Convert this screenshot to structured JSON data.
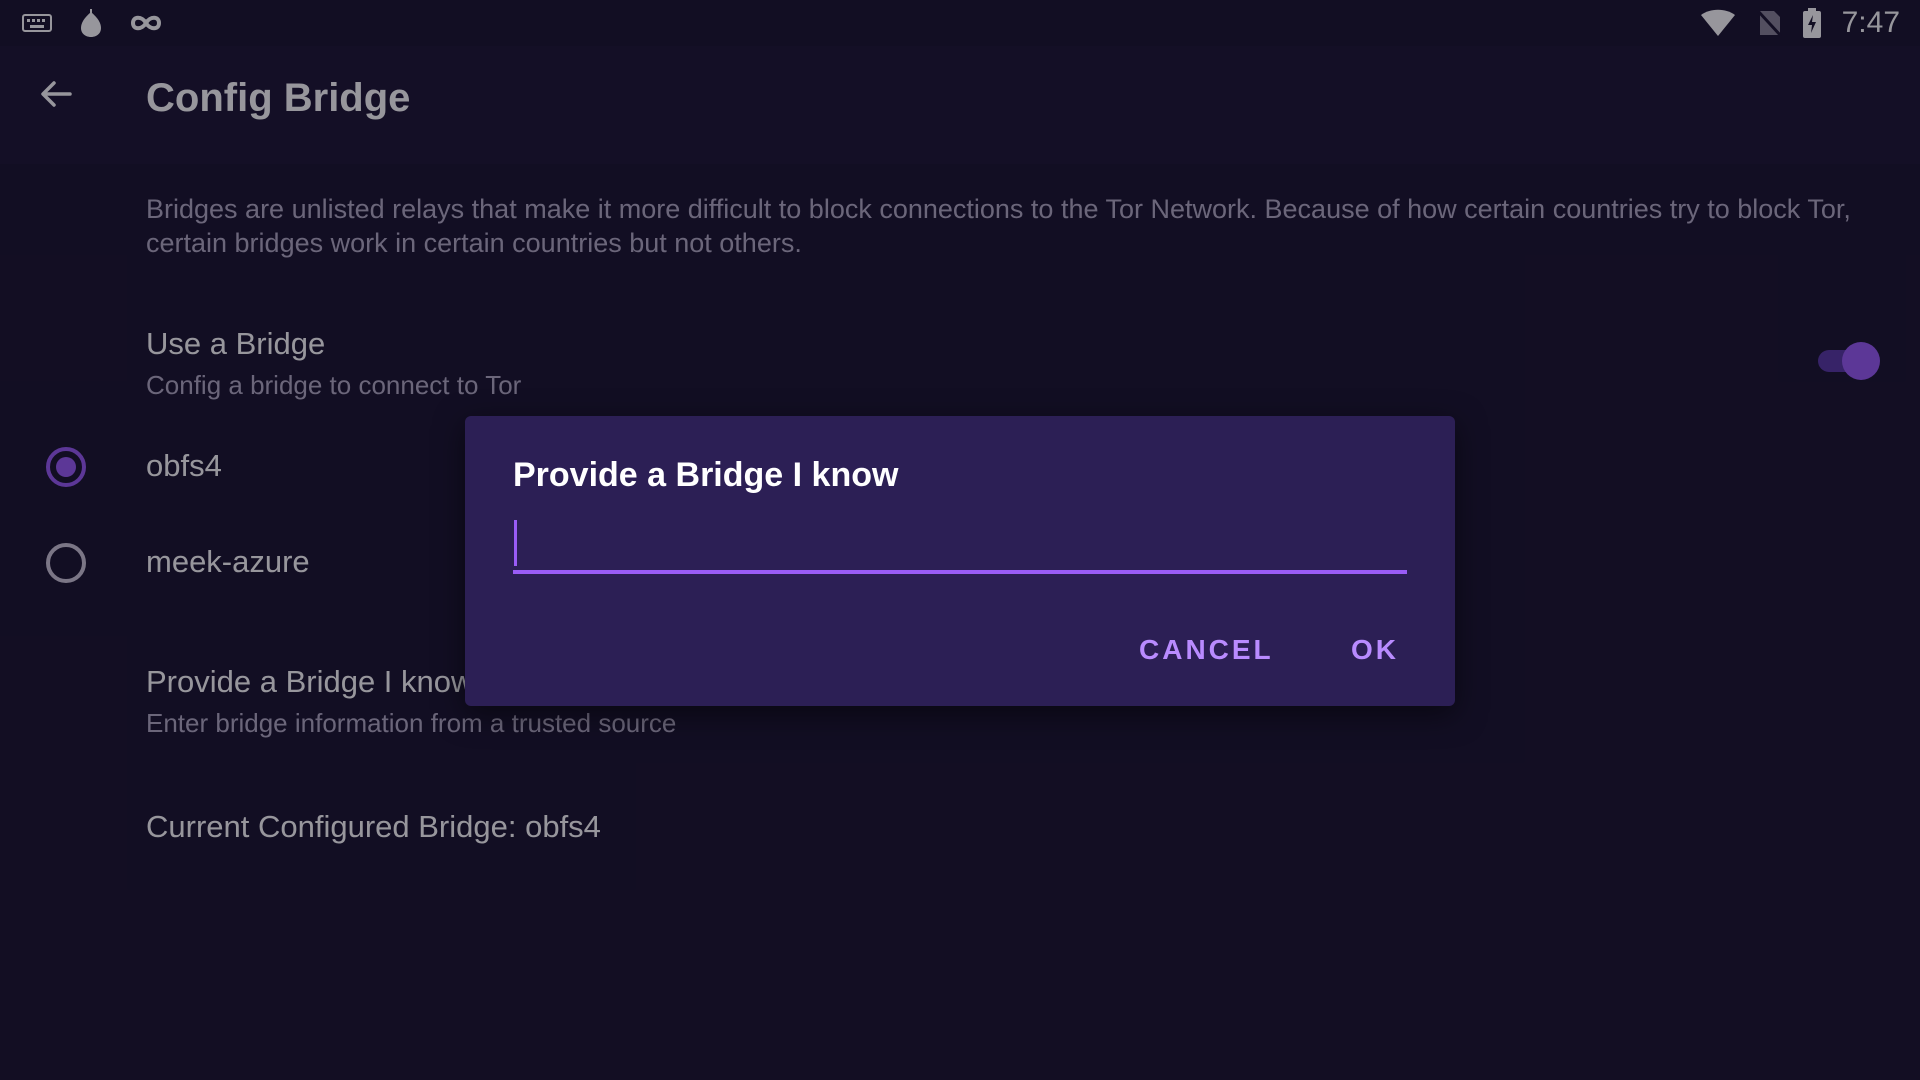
{
  "status_bar": {
    "time": "7:47",
    "left_icons": [
      "keyboard-icon",
      "onion-icon",
      "infinity-icon"
    ],
    "right_icons": [
      "wifi-icon",
      "no-sim-icon",
      "battery-charging-icon"
    ]
  },
  "app_bar": {
    "title": "Config Bridge",
    "back_icon": "arrow-back-icon"
  },
  "content": {
    "description": "Bridges are unlisted relays that make it more difficult to block connections to the Tor Network. Because of how certain countries try to block Tor, certain bridges work in certain countries but not others.",
    "use_bridge": {
      "title": "Use a Bridge",
      "subtitle": "Config a bridge to connect to Tor",
      "enabled": true
    },
    "bridge_options": [
      {
        "label": "obfs4",
        "selected": true
      },
      {
        "label": "meek-azure",
        "selected": false
      }
    ],
    "provide_bridge": {
      "title": "Provide a Bridge I know",
      "subtitle": "Enter bridge information from a trusted source"
    },
    "current_bridge": "Current Configured Bridge: obfs4"
  },
  "dialog": {
    "title": "Provide a Bridge I know",
    "input_value": "",
    "cancel_label": "CANCEL",
    "ok_label": "OK"
  },
  "colors": {
    "background": "#1b1530",
    "dialog_background": "#2c1f55",
    "accent": "#9a5cf6",
    "button_text": "#b98bff"
  }
}
